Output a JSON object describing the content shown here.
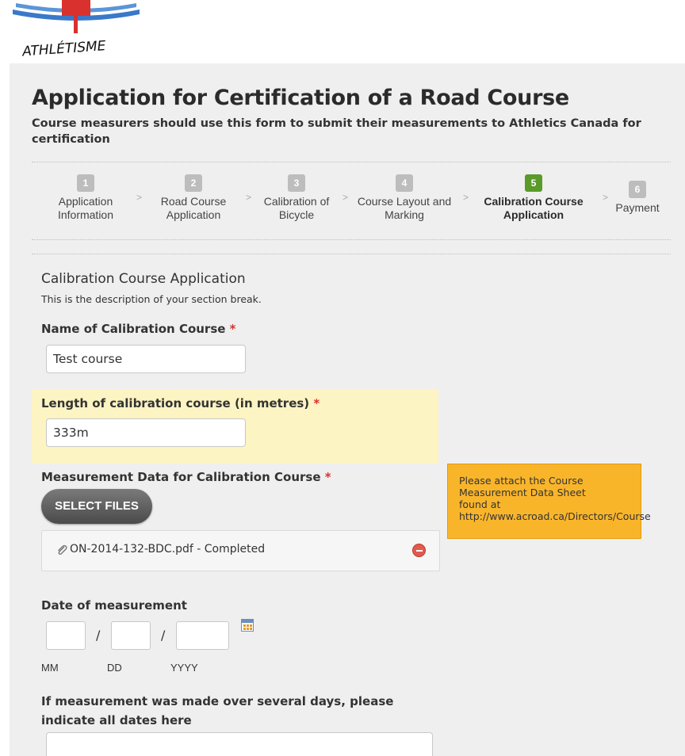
{
  "logo": {
    "text": "ATHLÉTISME",
    "colors": {
      "red": "#d9312d",
      "blue": "#3a79c9"
    }
  },
  "header": {
    "title": "Application for Certification of a Road Course",
    "subtitle": "Course measurers should use this form to submit their measurements to Athletics Canada for certification"
  },
  "steps": [
    {
      "num": "1",
      "line1": "Application",
      "line2": "Information",
      "active": false
    },
    {
      "num": "2",
      "line1": "Road Course",
      "line2": "Application",
      "active": false
    },
    {
      "num": "3",
      "line1": "Calibration of",
      "line2": "Bicycle",
      "active": false
    },
    {
      "num": "4",
      "line1": "Course Layout and",
      "line2": "Marking",
      "active": false
    },
    {
      "num": "5",
      "line1": "Calibration Course",
      "line2": "Application",
      "active": true
    },
    {
      "num": "6",
      "line1": "Payment",
      "line2": "",
      "active": false
    }
  ],
  "step_separator": ">",
  "section": {
    "title": "Calibration Course Application",
    "description": "This is the description of your section break."
  },
  "fields": {
    "name": {
      "label": "Name of Calibration Course",
      "required_mark": "*",
      "value": "Test course"
    },
    "length": {
      "label": "Length of calibration course (in metres)",
      "required_mark": "*",
      "value": "333m"
    },
    "measurement_data": {
      "label": "Measurement Data for Calibration Course",
      "required_mark": "*",
      "button": "SELECT FILES",
      "file": "ON-2014-132-BDC.pdf - Completed"
    },
    "date": {
      "label": "Date of measurement",
      "separator": "/",
      "sublabels": {
        "mm": "MM",
        "dd": "DD",
        "yyyy": "YYYY"
      }
    },
    "multi_dates": {
      "label_line1": "If measurement was made over several days, please",
      "label_line2": "indicate all dates here"
    }
  },
  "tooltip": {
    "line1": "Please attach the Course",
    "line2": "Measurement Data Sheet",
    "line3": "found at",
    "url": "http://www.acroad.ca/Directors/Course"
  },
  "colors": {
    "active_step": "#5a9a2a",
    "inactive_step": "#bdbdbd",
    "highlight": "#fdf4c3",
    "tooltip": "#f9b52a",
    "required": "#d9312d"
  }
}
